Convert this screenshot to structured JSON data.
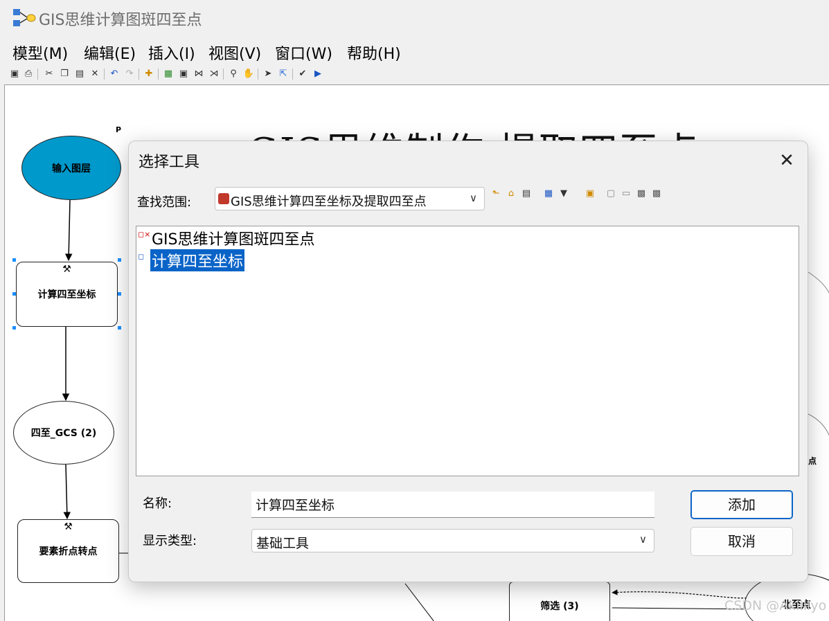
{
  "window": {
    "title": "GIS思维计算图斑四至点"
  },
  "menu": [
    "模型(M)",
    "编辑(E)",
    "插入(I)",
    "视图(V)",
    "窗口(W)",
    "帮助(H)"
  ],
  "toolbar_icons": [
    "save-icon",
    "print-icon",
    "cut-icon",
    "copy-icon",
    "paste-icon",
    "delete-icon",
    "undo-icon",
    "redo-icon",
    "add-data-icon",
    "auto-layout-icon",
    "full-extent-icon",
    "zoom-in-fixed-icon",
    "zoom-out-fixed-icon",
    "zoom-in-icon",
    "pan-icon",
    "select-icon",
    "connect-icon",
    "validate-icon",
    "run-icon"
  ],
  "canvas": {
    "heading": "GIS思维制作  提取四至点",
    "small_label": "P",
    "nodes": {
      "input_layer": "输入图层",
      "calc_coords": "计算四至坐标",
      "output_gcs": "四至_GCS (2)",
      "vertices_to_points": "要素折点转点",
      "filter3": "筛选 (3)",
      "north_point": "北至点",
      "partial_point": "点"
    },
    "colors": {
      "input_fill": "#0099cc"
    }
  },
  "dialog": {
    "title": "选择工具",
    "look_in_label": "查找范围:",
    "look_in_value": "GIS思维计算四至坐标及提取四至点",
    "list_items": [
      {
        "label": "GIS思维计算图斑四至点",
        "selected": false
      },
      {
        "label": "计算四至坐标",
        "selected": true
      }
    ],
    "name_label": "名称:",
    "name_value": "计算四至坐标",
    "type_label": "显示类型:",
    "type_value": "基础工具",
    "add_button": "添加",
    "cancel_button": "取消",
    "accent": "#0a64c8"
  },
  "watermark": "CSDN @Akilliyo"
}
